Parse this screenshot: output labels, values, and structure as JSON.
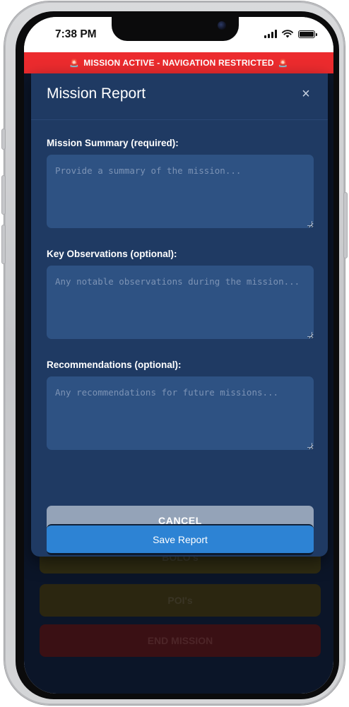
{
  "status_bar": {
    "time": "7:38 PM"
  },
  "banner": {
    "text": "MISSION ACTIVE - NAVIGATION RESTRICTED",
    "icon": "siren-icon"
  },
  "background_buttons": {
    "bolos": "BOLO's",
    "pois": "POI's",
    "end_mission": "END MISSION"
  },
  "modal": {
    "title": "Mission Report",
    "close_label": "×",
    "fields": [
      {
        "label": "Mission Summary (required):",
        "placeholder": "Provide a summary of the mission...",
        "value": ""
      },
      {
        "label": "Key Observations (optional):",
        "placeholder": "Any notable observations during the mission...",
        "value": ""
      },
      {
        "label": "Recommendations (optional):",
        "placeholder": "Any recommendations for future missions...",
        "value": ""
      }
    ],
    "cancel_label": "CANCEL",
    "save_label": "Save Report"
  },
  "colors": {
    "banner": "#ec2b2e",
    "modal_bg": "#1f3a63",
    "textarea_bg": "#2e5283",
    "cancel": "#94a3b8",
    "save": "#2d83d4"
  }
}
